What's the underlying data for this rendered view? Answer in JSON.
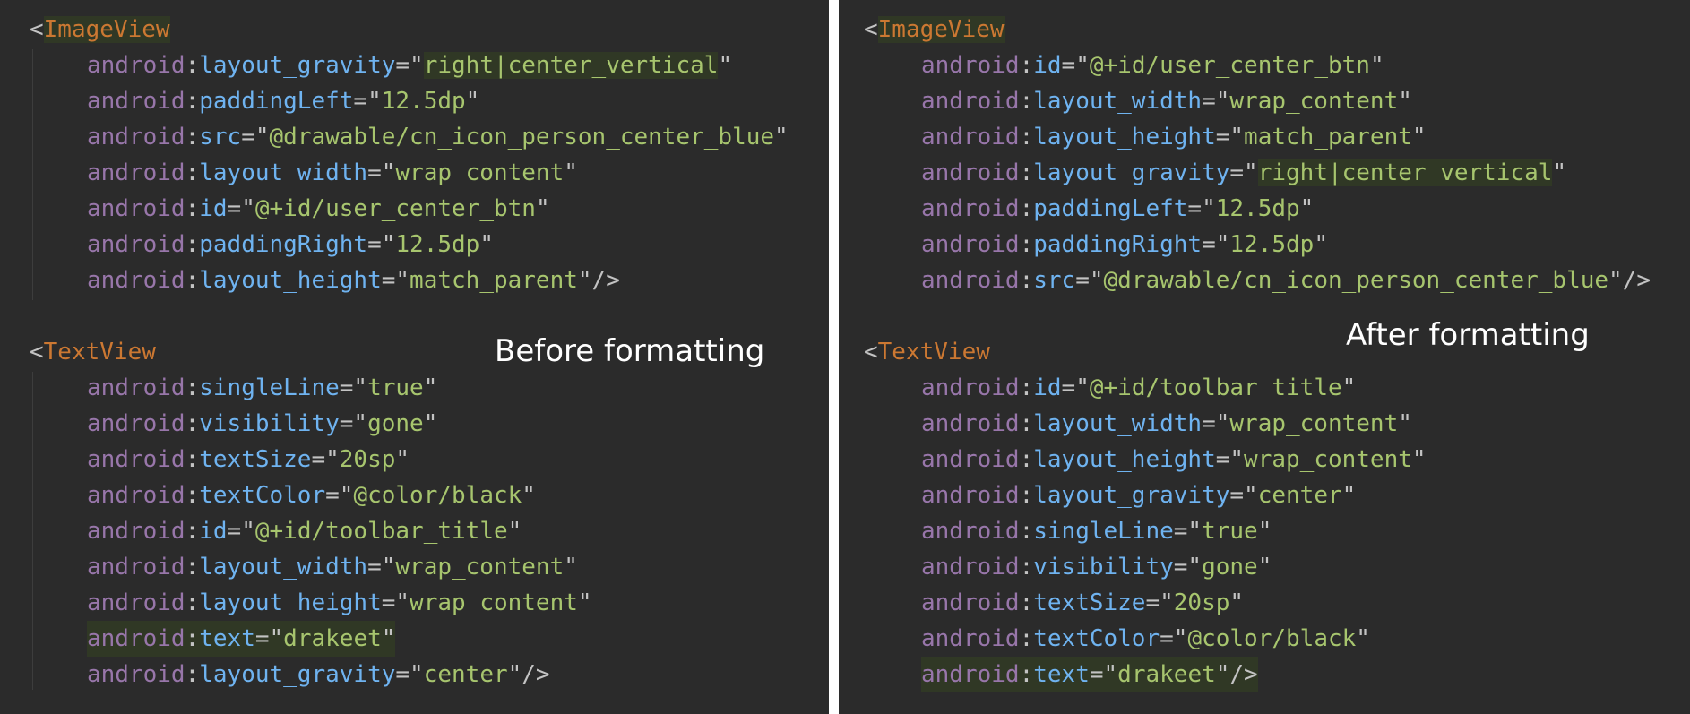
{
  "left": {
    "caption": "Before formatting",
    "blocks": [
      {
        "tag": "ImageView",
        "attrs": [
          {
            "name": "layout_gravity",
            "value": "right|center_vertical"
          },
          {
            "name": "paddingLeft",
            "value": "12.5dp"
          },
          {
            "name": "src",
            "value": "@drawable/cn_icon_person_center_blue"
          },
          {
            "name": "layout_width",
            "value": "wrap_content"
          },
          {
            "name": "id",
            "value": "@+id/user_center_btn"
          },
          {
            "name": "paddingRight",
            "value": "12.5dp"
          },
          {
            "name": "layout_height",
            "value": "match_parent"
          }
        ]
      },
      {
        "tag": "TextView",
        "attrs": [
          {
            "name": "singleLine",
            "value": "true"
          },
          {
            "name": "visibility",
            "value": "gone"
          },
          {
            "name": "textSize",
            "value": "20sp"
          },
          {
            "name": "textColor",
            "value": "@color/black"
          },
          {
            "name": "id",
            "value": "@+id/toolbar_title"
          },
          {
            "name": "layout_width",
            "value": "wrap_content"
          },
          {
            "name": "layout_height",
            "value": "wrap_content"
          },
          {
            "name": "text",
            "value": "drakeet"
          },
          {
            "name": "layout_gravity",
            "value": "center"
          }
        ]
      }
    ]
  },
  "right": {
    "caption": "After formatting",
    "blocks": [
      {
        "tag": "ImageView",
        "attrs": [
          {
            "name": "id",
            "value": "@+id/user_center_btn"
          },
          {
            "name": "layout_width",
            "value": "wrap_content"
          },
          {
            "name": "layout_height",
            "value": "match_parent"
          },
          {
            "name": "layout_gravity",
            "value": "right|center_vertical"
          },
          {
            "name": "paddingLeft",
            "value": "12.5dp"
          },
          {
            "name": "paddingRight",
            "value": "12.5dp"
          },
          {
            "name": "src",
            "value": "@drawable/cn_icon_person_center_blue"
          }
        ]
      },
      {
        "tag": "TextView",
        "attrs": [
          {
            "name": "id",
            "value": "@+id/toolbar_title"
          },
          {
            "name": "layout_width",
            "value": "wrap_content"
          },
          {
            "name": "layout_height",
            "value": "wrap_content"
          },
          {
            "name": "layout_gravity",
            "value": "center"
          },
          {
            "name": "singleLine",
            "value": "true"
          },
          {
            "name": "visibility",
            "value": "gone"
          },
          {
            "name": "textSize",
            "value": "20sp"
          },
          {
            "name": "textColor",
            "value": "@color/black"
          },
          {
            "name": "text",
            "value": "drakeet"
          }
        ]
      }
    ]
  },
  "syntax": {
    "namespace": "android",
    "open_bracket": "<",
    "self_close": "/>",
    "colors": {
      "background": "#2b2b2b",
      "tag": "#cc7832",
      "namespace": "#9876aa",
      "attribute": "#6fb3f0",
      "value": "#a7c56e",
      "highlight": "#303825"
    }
  }
}
